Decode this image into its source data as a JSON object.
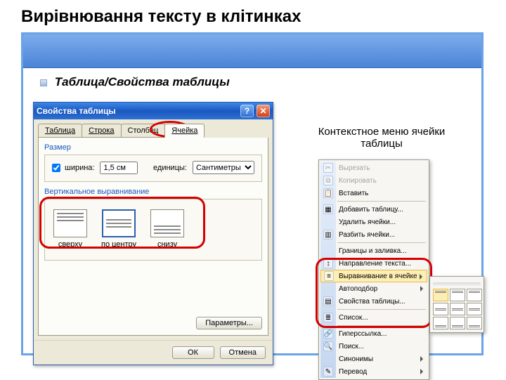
{
  "page_title": "Вирівнювання тексту в клітинках",
  "subtitle": "Таблица/Свойства таблицы",
  "dialog": {
    "title": "Свойства таблицы",
    "help_symbol": "?",
    "close_symbol": "✕",
    "tabs": {
      "table": "Таблица",
      "row": "Строка",
      "column": "Столбец",
      "cell": "Ячейка"
    },
    "size_group_label": "Размер",
    "width_checkbox_label": "ширина:",
    "width_value": "1,5 см",
    "units_label": "единицы:",
    "units_value": "Сантиметры",
    "valign_group_label": "Вертикальное выравнивание",
    "valign_top": "сверху",
    "valign_center": "по центру",
    "valign_bottom": "снизу",
    "params_button": "Параметры...",
    "ok_button": "ОК",
    "cancel_button": "Отмена"
  },
  "context_caption": "Контекстное меню ячейки таблицы",
  "ctx": {
    "cut": "Вырезать",
    "copy": "Копировать",
    "paste": "Вставить",
    "insert_table": "Добавить таблицу...",
    "delete_cells": "Удалить ячейки...",
    "split_cells": "Разбить ячейки...",
    "borders": "Границы и заливка...",
    "text_direction": "Направление текста...",
    "cell_alignment": "Выравнивание в ячейке",
    "autofit": "Автоподбор",
    "table_props": "Свойства таблицы...",
    "list": "Список...",
    "hyperlink": "Гиперссылка...",
    "find": "Поиск...",
    "synonyms": "Синонимы",
    "translate": "Перевод"
  }
}
